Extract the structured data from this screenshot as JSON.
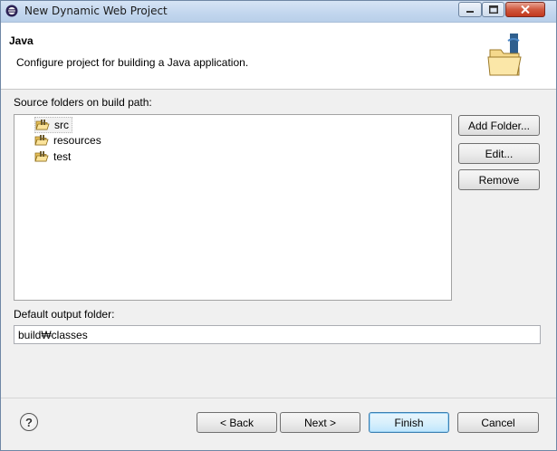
{
  "window": {
    "title": "New Dynamic Web Project"
  },
  "header": {
    "title": "Java",
    "description": "Configure project for building a Java application."
  },
  "source_folders": {
    "label": "Source folders on build path:",
    "items": [
      {
        "label": "src",
        "selected": true
      },
      {
        "label": "resources",
        "selected": false
      },
      {
        "label": "test",
        "selected": false
      }
    ],
    "buttons": {
      "add_folder": "Add Folder...",
      "edit": "Edit...",
      "remove": "Remove"
    }
  },
  "output": {
    "label": "Default output folder:",
    "value": "build₩classes"
  },
  "footer": {
    "help_icon": "question-icon",
    "back": "< Back",
    "next": "Next >",
    "finish": "Finish",
    "cancel": "Cancel"
  },
  "colors": {
    "title_bar": "#c2d6ee",
    "close_button": "#c2391e",
    "default_button_border": "#3c7fb1"
  }
}
